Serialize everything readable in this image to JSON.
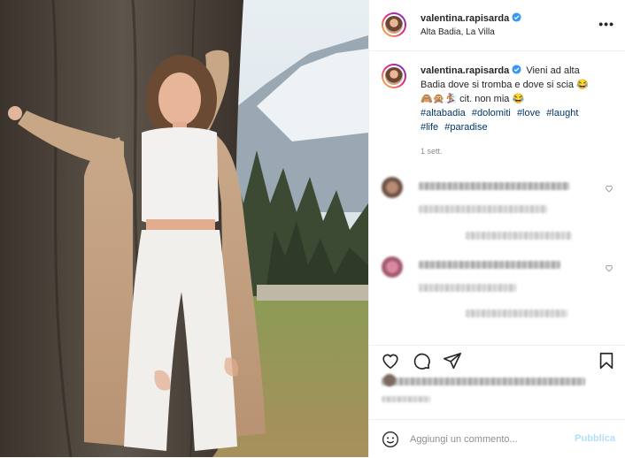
{
  "post": {
    "username": "valentina.rapisarda",
    "verified": true,
    "location": "Alta Badia, La Villa",
    "more_label": "•••"
  },
  "caption": {
    "username": "valentina.rapisarda",
    "text_line1": "Vieni ad alta",
    "text_line2": "Badia dove si tromba e dove si scia 😂",
    "text_line3": "🙈🙊🏂 cit. non mia 😂",
    "hashtags": [
      "#altabadia",
      "#dolomiti",
      "#love",
      "#laught",
      "#life",
      "#paradise"
    ],
    "time": "1 sett."
  },
  "icons": {
    "verified": "verified-badge-icon",
    "like": "heart-icon",
    "comment": "comment-icon",
    "share": "paper-plane-icon",
    "save": "bookmark-icon",
    "emoji": "smiley-icon"
  },
  "add_comment": {
    "placeholder": "Aggiungi un commento...",
    "publish_label": "Pubblica"
  },
  "colors": {
    "link": "#00376b",
    "verified": "#3897f0",
    "publish_disabled": "#b2dffc",
    "muted": "#8e8e8e"
  }
}
